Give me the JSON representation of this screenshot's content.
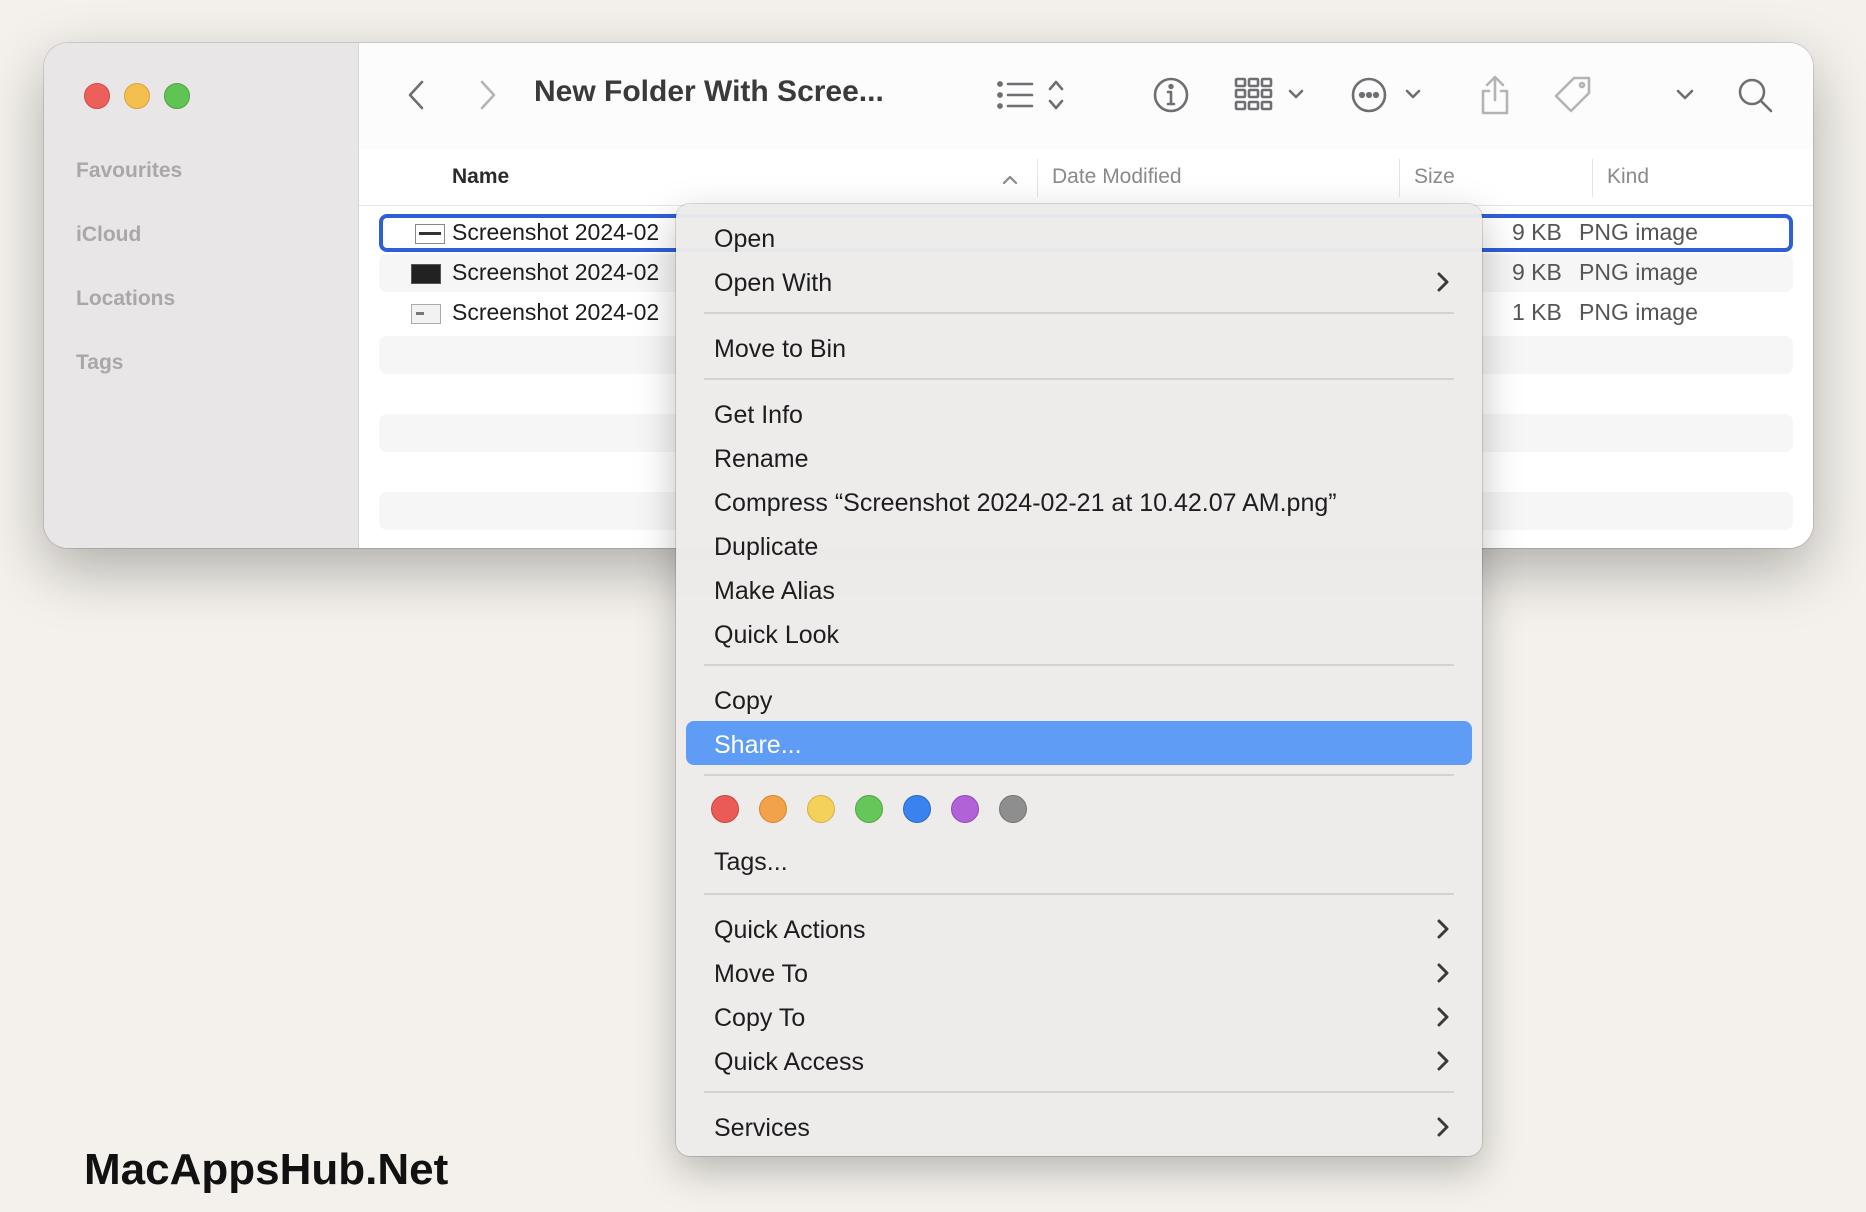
{
  "window": {
    "title": "New Folder With Scree...",
    "sidebar": {
      "sections": [
        "Favourites",
        "iCloud",
        "Locations",
        "Tags"
      ]
    },
    "toolbar": {
      "icons": [
        "back-icon",
        "forward-icon",
        "list-view-icon",
        "info-icon",
        "group-icon",
        "more-icon",
        "share-icon",
        "tag-icon",
        "expand-icon",
        "search-icon"
      ]
    },
    "columns": {
      "name": "Name",
      "date": "Date Modified",
      "size": "Size",
      "kind": "Kind"
    },
    "files": [
      {
        "name": "Screenshot 2024-02",
        "size": "9 KB",
        "kind": "PNG image"
      },
      {
        "name": "Screenshot 2024-02",
        "size": "9 KB",
        "kind": "PNG image"
      },
      {
        "name": "Screenshot 2024-02",
        "size": "1 KB",
        "kind": "PNG image"
      }
    ]
  },
  "context_menu": {
    "items": {
      "open": "Open",
      "open_with": "Open With",
      "move_to_bin": "Move to Bin",
      "get_info": "Get Info",
      "rename": "Rename",
      "compress": "Compress “Screenshot 2024-02-21 at 10.42.07 AM.png”",
      "duplicate": "Duplicate",
      "make_alias": "Make Alias",
      "quick_look": "Quick Look",
      "copy": "Copy",
      "share": "Share...",
      "tags": "Tags...",
      "quick_actions": "Quick Actions",
      "move_to": "Move To",
      "copy_to": "Copy To",
      "quick_access": "Quick Access",
      "services": "Services"
    },
    "tag_colors": [
      "#ea5b57",
      "#f1a24a",
      "#f4d15b",
      "#66c65a",
      "#3b82f1",
      "#b062d6",
      "#8e8e8e"
    ]
  },
  "watermark": "MacAppsHub.Net"
}
